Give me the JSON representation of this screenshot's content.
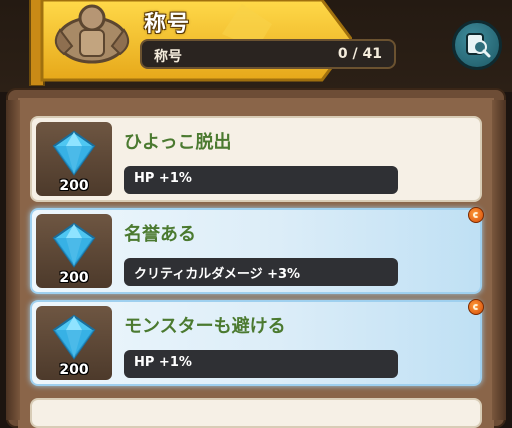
{
  "header": {
    "title": "称号",
    "progress_label": "称号",
    "progress_count": "0 / 41"
  },
  "search_button": {
    "icon": "search-icon"
  },
  "colors": {
    "banner": "#f2c232",
    "title_green": "#4b7a30",
    "effect_bg": "#2f3034"
  },
  "titles": [
    {
      "name": "ひよっこ脱出",
      "effect": "HP +1%",
      "gem_count": "200",
      "highlighted": false,
      "badge": false
    },
    {
      "name": "名誉ある",
      "effect": "クリティカルダメージ +3%",
      "gem_count": "200",
      "highlighted": true,
      "badge": true
    },
    {
      "name": "モンスターも避ける",
      "effect": "HP +1%",
      "gem_count": "200",
      "highlighted": true,
      "badge": true
    }
  ]
}
